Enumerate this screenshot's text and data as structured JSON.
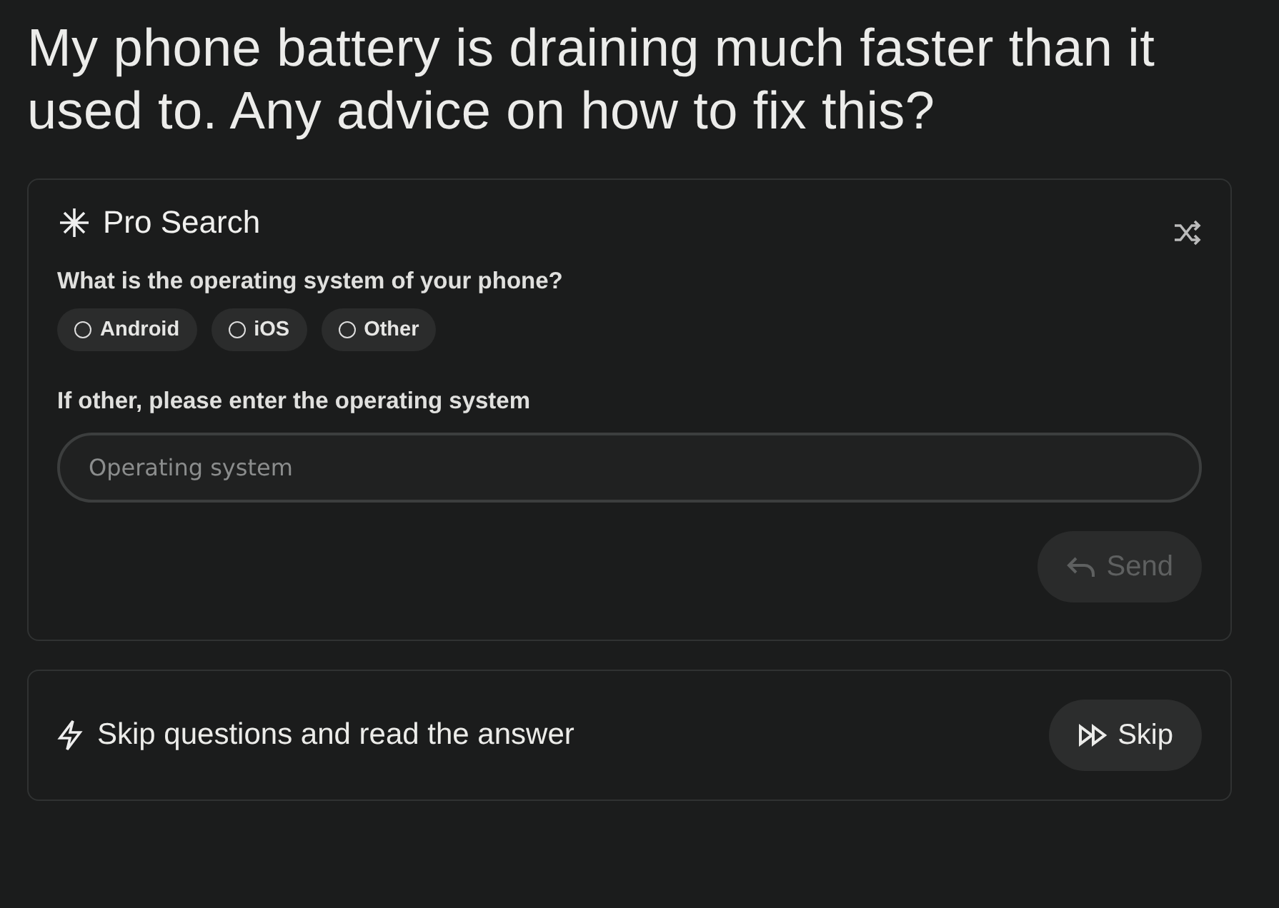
{
  "question": "My phone battery is draining much faster than it used to. Any advice on how to fix this?",
  "pro_search": {
    "title": "Pro Search",
    "prompt": "What is the operating system of your phone?",
    "options": [
      {
        "label": "Android",
        "selected": false
      },
      {
        "label": "iOS",
        "selected": false
      },
      {
        "label": "Other",
        "selected": false
      }
    ],
    "other_label": "If other, please enter the operating system",
    "field": {
      "placeholder": "Operating system"
    },
    "send": {
      "label": "Send",
      "disabled": true
    }
  },
  "skip_bar": {
    "text": "Skip questions and read the answer",
    "button": "Skip"
  }
}
